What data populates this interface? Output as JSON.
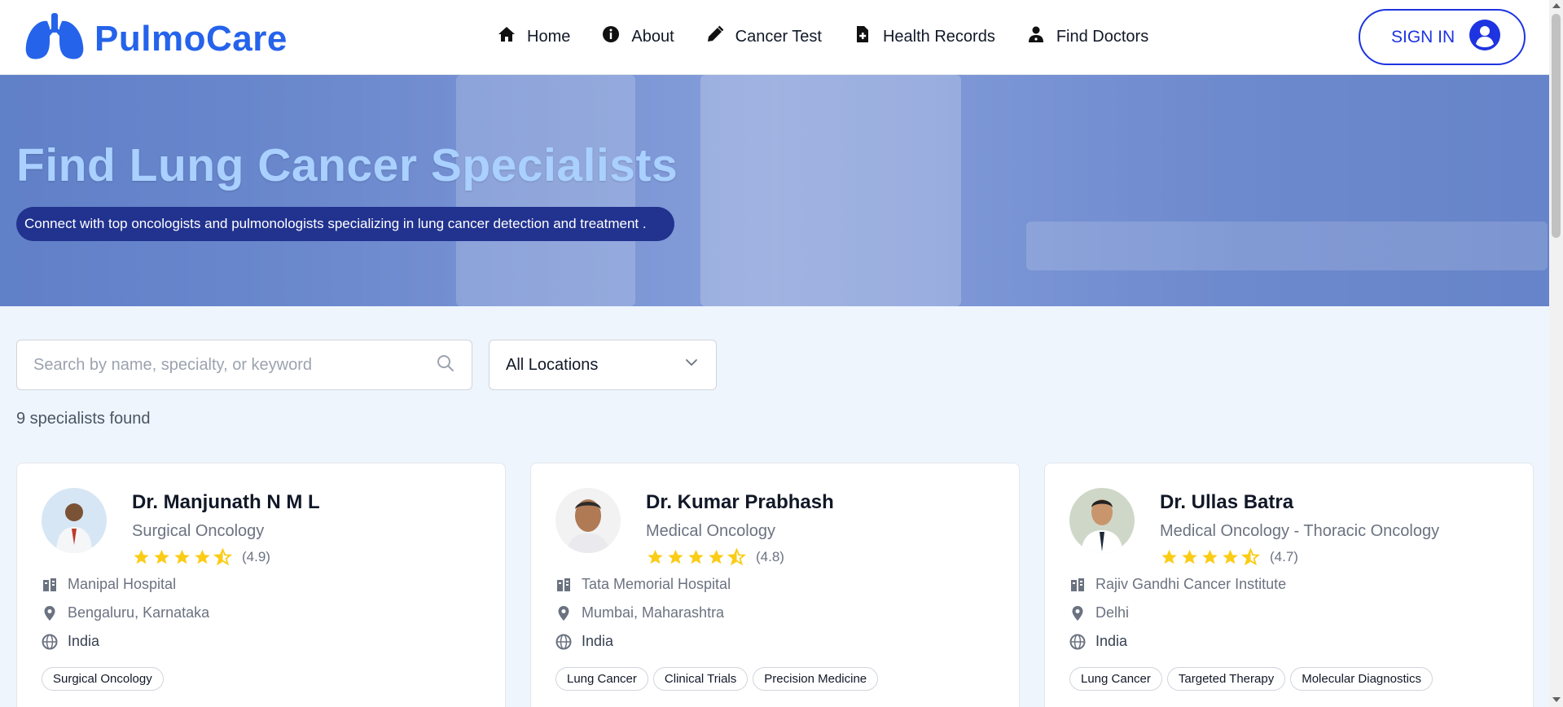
{
  "brand": {
    "name": "PulmoCare",
    "icon": "lungs-icon",
    "color": "#2563eb"
  },
  "nav": [
    {
      "label": "Home",
      "icon": "home-icon"
    },
    {
      "label": "About",
      "icon": "info-icon"
    },
    {
      "label": "Cancer Test",
      "icon": "pencil-icon"
    },
    {
      "label": "Health Records",
      "icon": "file-medical-icon"
    },
    {
      "label": "Find Doctors",
      "icon": "user-doctor-icon"
    }
  ],
  "signin": {
    "label": "SIGN IN",
    "icon": "user-circle-icon",
    "color": "#1d34e0"
  },
  "hero": {
    "title": "Find Lung Cancer Specialists",
    "subtitle": "Connect with top oncologists and pulmonologists specializing in lung cancer detection and treatment ."
  },
  "search": {
    "placeholder": "Search by name, specialty, or keyword",
    "icon": "search-icon"
  },
  "location_filter": {
    "selected": "All Locations",
    "icon": "chevron-down-icon"
  },
  "results": {
    "count_text": "9 specialists found"
  },
  "doctors": [
    {
      "name": "Dr. Manjunath N M L",
      "specialty": "Surgical Oncology",
      "rating": 4.9,
      "rating_text": "(4.9)",
      "hospital": "Manipal Hospital",
      "location": "Bengaluru, Karnataka",
      "country": "India",
      "tags": [
        "Surgical Oncology"
      ]
    },
    {
      "name": "Dr. Kumar Prabhash",
      "specialty": "Medical Oncology",
      "rating": 4.8,
      "rating_text": "(4.8)",
      "hospital": "Tata Memorial Hospital",
      "location": "Mumbai, Maharashtra",
      "country": "India",
      "tags": [
        "Lung Cancer",
        "Clinical Trials",
        "Precision Medicine"
      ]
    },
    {
      "name": "Dr. Ullas Batra",
      "specialty": "Medical Oncology - Thoracic Oncology",
      "rating": 4.7,
      "rating_text": "(4.7)",
      "hospital": "Rajiv Gandhi Cancer Institute",
      "location": "Delhi",
      "country": "India",
      "tags": [
        "Lung Cancer",
        "Targeted Therapy",
        "Molecular Diagnostics"
      ]
    }
  ],
  "colors": {
    "star": "#facc15",
    "accent": "#1d34e0",
    "hero_subtitle_bg": "#21328f"
  }
}
